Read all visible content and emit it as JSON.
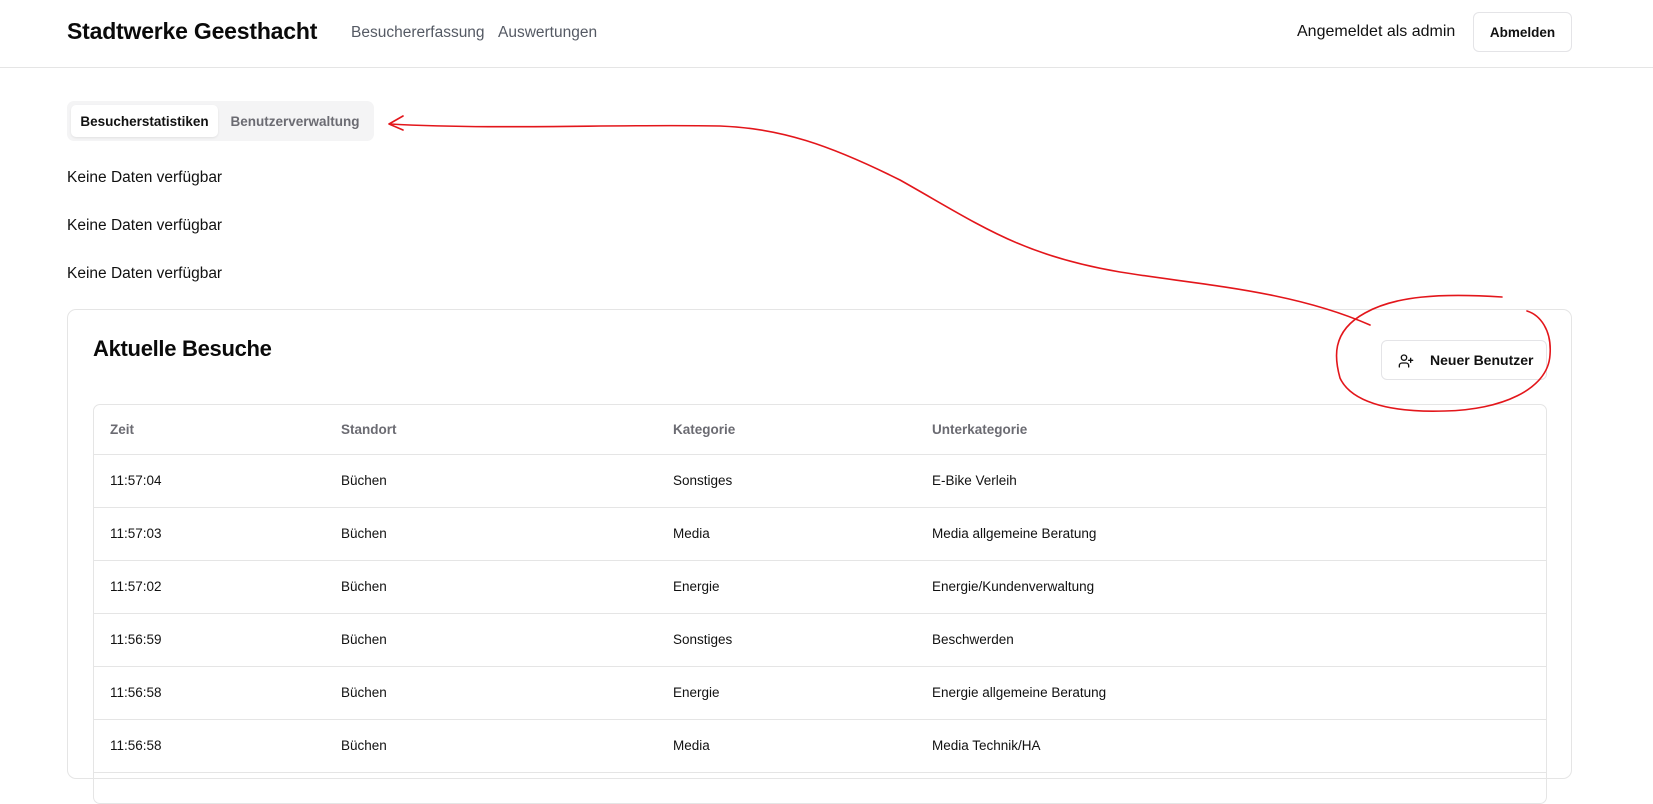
{
  "header": {
    "brand": "Stadtwerke Geesthacht",
    "nav": [
      "Besuchererfassung",
      "Auswertungen"
    ],
    "user_label": "Angemeldet als admin",
    "logout_label": "Abmelden"
  },
  "tabs": {
    "active": "Besucherstatistiken",
    "inactive": "Benutzerverwaltung"
  },
  "empty_messages": [
    "Keine Daten verfügbar",
    "Keine Daten verfügbar",
    "Keine Daten verfügbar"
  ],
  "card": {
    "title": "Aktuelle Besuche",
    "new_user_label": "Neuer Benutzer",
    "new_user_icon": "user-plus-icon"
  },
  "table": {
    "columns": [
      "Zeit",
      "Standort",
      "Kategorie",
      "Unterkategorie"
    ],
    "rows": [
      [
        "11:57:04",
        "Büchen",
        "Sonstiges",
        "E-Bike Verleih"
      ],
      [
        "11:57:03",
        "Büchen",
        "Media",
        "Media allgemeine Beratung"
      ],
      [
        "11:57:02",
        "Büchen",
        "Energie",
        "Energie/Kundenverwaltung"
      ],
      [
        "11:56:59",
        "Büchen",
        "Sonstiges",
        "Beschwerden"
      ],
      [
        "11:56:58",
        "Büchen",
        "Energie",
        "Energie allgemeine Beratung"
      ],
      [
        "11:56:58",
        "Büchen",
        "Media",
        "Media Technik/HA"
      ]
    ]
  },
  "annotation_color": "#e3161b"
}
